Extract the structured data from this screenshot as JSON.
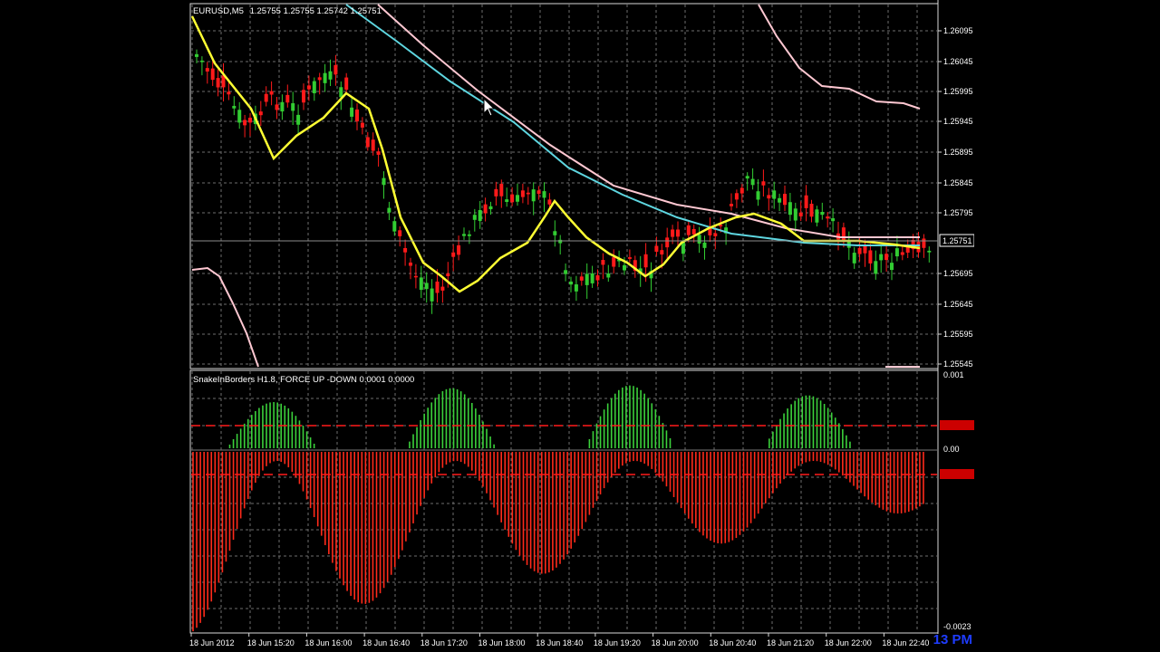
{
  "main_chart": {
    "title_symbol": "EURUSD,M5",
    "title_ohlc": "1.25755 1.25755 1.25742 1.25751",
    "current_price": "1.25751",
    "price_labels": [
      "1.26095",
      "1.26045",
      "1.25995",
      "1.25945",
      "1.25895",
      "1.25845",
      "1.25795",
      "1.25695",
      "1.25645",
      "1.25595",
      "1.25545"
    ],
    "bull_color": "#32cd32",
    "bear_color": "#ff1a1a",
    "fast_ma_color": "#ffff33",
    "slow_ma_color": "#5ed6e0",
    "band_color": "#ffc8d2"
  },
  "indicator": {
    "title": "SnakeInBorders H1.8, FORCE UP -DOWN  0.0001 0.0000",
    "labels": [
      "0.001",
      "0.00",
      "-0.0023"
    ],
    "level_color": "#ff1a1a"
  },
  "time_axis": [
    "18 Jun 2012",
    "18 Jun 15:20",
    "18 Jun 16:00",
    "18 Jun 16:40",
    "18 Jun 17:20",
    "18 Jun 18:00",
    "18 Jun 18:40",
    "18 Jun 19:20",
    "18 Jun 20:00",
    "18 Jun 20:40",
    "18 Jun 21:20",
    "18 Jun 22:00",
    "18 Jun 22:40"
  ],
  "overlay_clock": "13 PM"
}
